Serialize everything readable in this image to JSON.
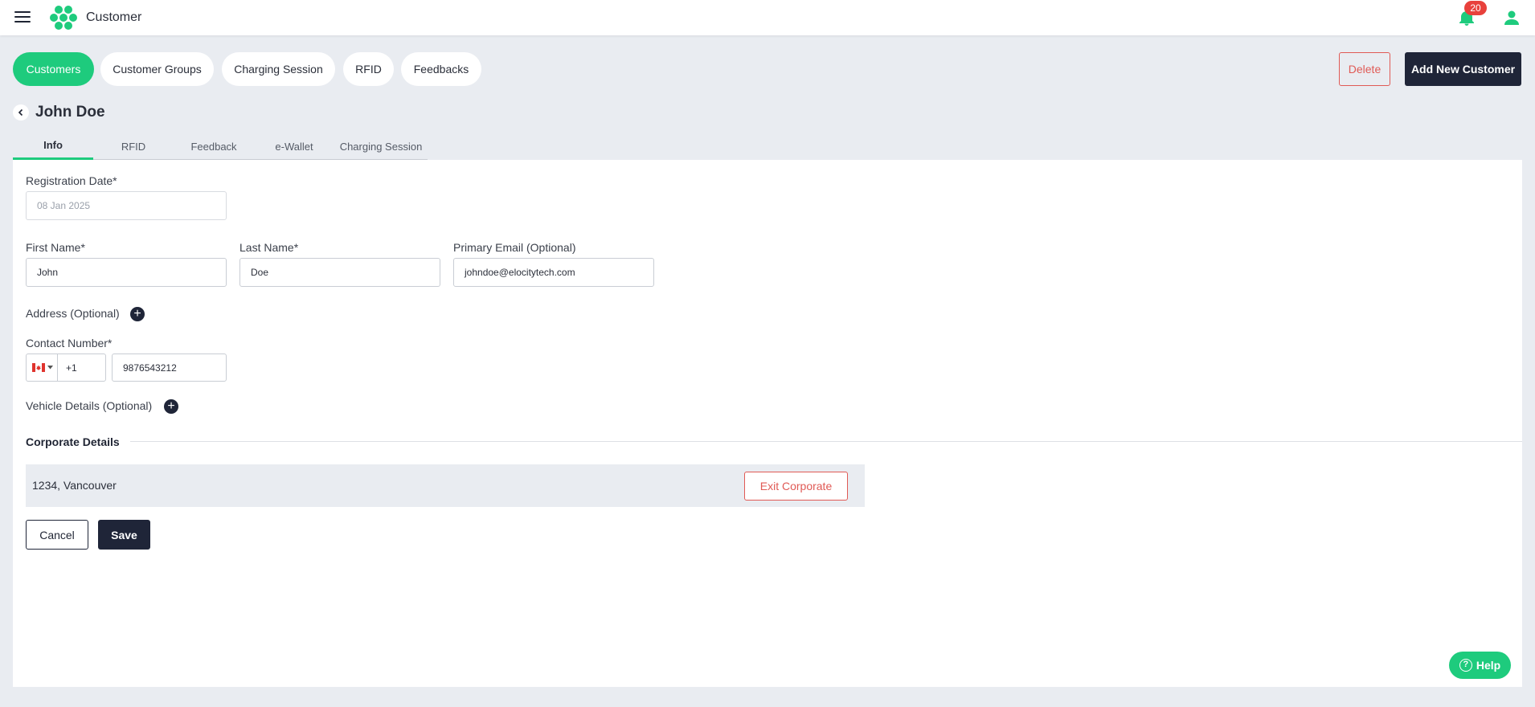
{
  "app": {
    "title": "Customer",
    "notification_count": "20"
  },
  "section_tabs": [
    {
      "label": "Customers",
      "active": true
    },
    {
      "label": "Customer Groups",
      "active": false
    },
    {
      "label": "Charging Session",
      "active": false
    },
    {
      "label": "RFID",
      "active": false
    },
    {
      "label": "Feedbacks",
      "active": false
    }
  ],
  "actions": {
    "delete_label": "Delete",
    "add_label": "Add New Customer"
  },
  "page": {
    "title": "John Doe"
  },
  "sub_tabs": [
    {
      "label": "Info",
      "active": true
    },
    {
      "label": "RFID",
      "active": false
    },
    {
      "label": "Feedback",
      "active": false
    },
    {
      "label": "e-Wallet",
      "active": false
    },
    {
      "label": "Charging Session",
      "active": false
    }
  ],
  "form": {
    "registration_date": {
      "label": "Registration Date*",
      "value": "08 Jan 2025"
    },
    "first_name": {
      "label": "First Name*",
      "value": "John"
    },
    "last_name": {
      "label": "Last Name*",
      "value": "Doe"
    },
    "email": {
      "label": "Primary Email (Optional)",
      "value": "johndoe@elocitytech.com"
    },
    "address": {
      "label": "Address (Optional)"
    },
    "contact": {
      "label": "Contact Number*",
      "country_code": "+1",
      "number": "9876543212"
    },
    "vehicle": {
      "label": "Vehicle Details (Optional)"
    },
    "corporate": {
      "heading": "Corporate Details",
      "entry": "1234, Vancouver",
      "exit_label": "Exit Corporate"
    },
    "cancel_label": "Cancel",
    "save_label": "Save"
  },
  "help_label": "Help",
  "colors": {
    "accent": "#1ecb7d",
    "dark": "#1f2538",
    "danger": "#e05a55",
    "background": "#e9ecf1"
  },
  "icons": [
    "menu-icon",
    "logo-icon",
    "bell-icon",
    "user-icon",
    "chevron-left-icon",
    "plus-circle-icon",
    "canada-flag-icon",
    "caret-down-icon",
    "question-circle-icon"
  ]
}
